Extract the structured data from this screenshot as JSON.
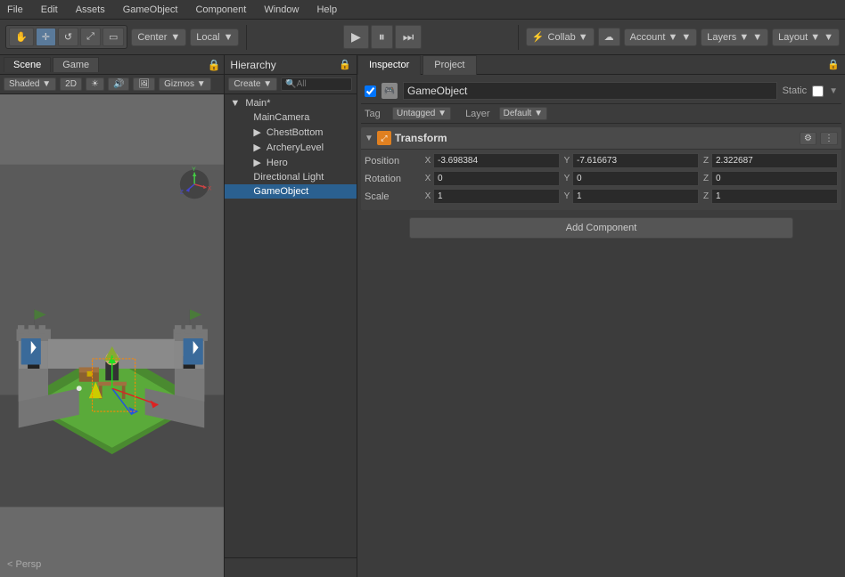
{
  "menubar": {
    "items": [
      "File",
      "Edit",
      "Assets",
      "GameObject",
      "Component",
      "Window",
      "Help"
    ]
  },
  "toolbar": {
    "tools": [
      "hand",
      "move",
      "rotate",
      "scale",
      "rect"
    ],
    "center_label": "Center",
    "local_label": "Local",
    "play_icon": "▶",
    "pause_icon": "⏸",
    "step_icon": "⏭",
    "collab_label": "Collab ▼",
    "cloud_icon": "☁",
    "account_label": "Account ▼",
    "layers_label": "Layers ▼",
    "layout_label": "Layout ▼"
  },
  "scene": {
    "tabs": [
      "Scene",
      "Game"
    ],
    "view_mode": "Shaded",
    "dim_label": "2D",
    "gizmos_label": "Gizmos ▼",
    "persp_label": "< Persp"
  },
  "hierarchy": {
    "title": "Hierarchy",
    "create_label": "Create",
    "search_placeholder": "🔍All",
    "items": [
      {
        "label": "Main*",
        "type": "group",
        "expanded": true
      },
      {
        "label": "MainCamera",
        "type": "child",
        "depth": 1
      },
      {
        "label": "ChestBottom",
        "type": "child",
        "depth": 1
      },
      {
        "label": "ArcheryLevel",
        "type": "child",
        "depth": 1
      },
      {
        "label": "Hero",
        "type": "child",
        "depth": 1
      },
      {
        "label": "Directional Light",
        "type": "child",
        "depth": 1
      },
      {
        "label": "GameObject",
        "type": "child",
        "depth": 1,
        "selected": true
      }
    ]
  },
  "inspector": {
    "tabs": [
      "Inspector",
      "Project"
    ],
    "gameobject_name": "GameObject",
    "static_label": "Static",
    "tag_label": "Tag",
    "tag_value": "Untagged",
    "layer_label": "Layer",
    "layer_value": "Default",
    "component": {
      "title": "Transform",
      "position_label": "Position",
      "rotation_label": "Rotation",
      "scale_label": "Scale",
      "position": {
        "x": "-3.698384",
        "y": "-7.616673",
        "z": "2.322687"
      },
      "rotation": {
        "x": "0",
        "y": "0",
        "z": "0"
      },
      "scale": {
        "x": "1",
        "y": "1",
        "z": "1"
      }
    },
    "add_component_label": "Add Component"
  }
}
